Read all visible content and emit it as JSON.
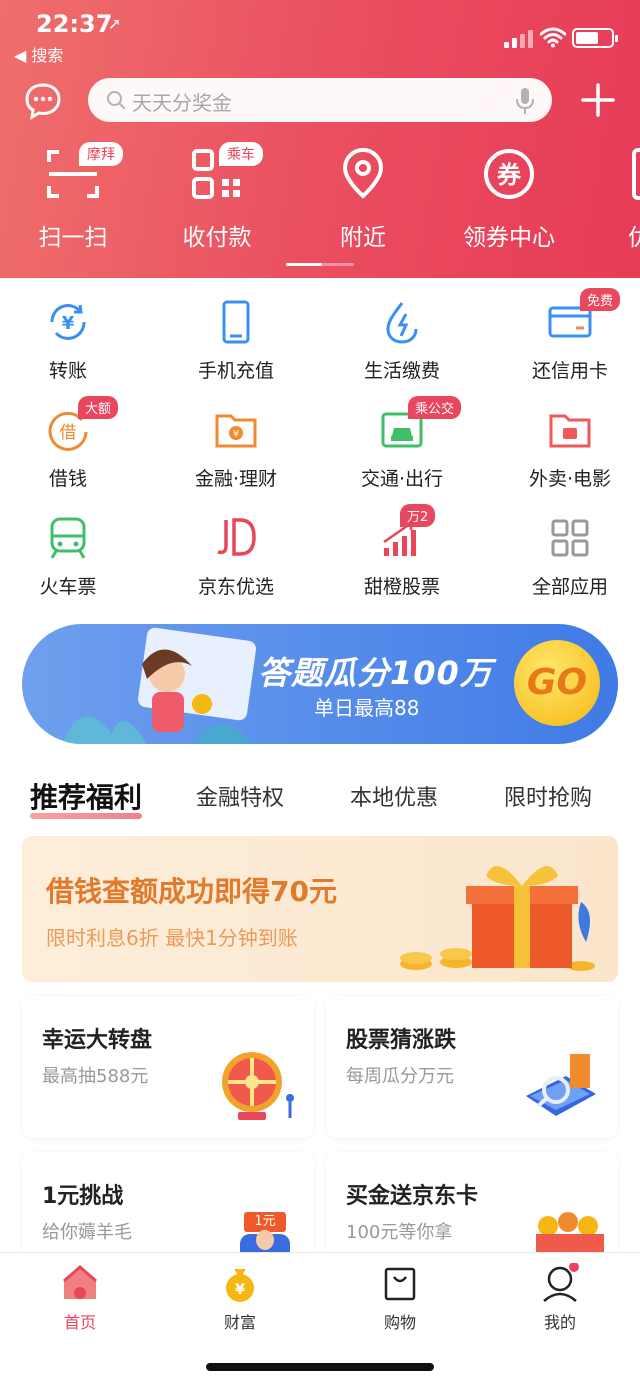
{
  "status": {
    "time": "22:37",
    "back_label": "◀ 搜索"
  },
  "search": {
    "placeholder": "天天分奖金"
  },
  "quick_actions": [
    {
      "label": "扫一扫",
      "badge": "摩拜"
    },
    {
      "label": "收付款",
      "badge": "乘车"
    },
    {
      "label": "附近",
      "badge": ""
    },
    {
      "label": "领券中心",
      "badge": "",
      "glyph": "券"
    },
    {
      "label": "优"
    }
  ],
  "services": [
    {
      "label": "转账",
      "badge": ""
    },
    {
      "label": "手机充值",
      "badge": ""
    },
    {
      "label": "生活缴费",
      "badge": ""
    },
    {
      "label": "还信用卡",
      "badge": "免费"
    },
    {
      "label": "借钱",
      "badge": "大额",
      "glyph": "借"
    },
    {
      "label": "金融·理财",
      "badge": ""
    },
    {
      "label": "交通·出行",
      "badge": "乘公交"
    },
    {
      "label": "外卖·电影",
      "badge": ""
    },
    {
      "label": "火车票",
      "badge": ""
    },
    {
      "label": "京东优选",
      "badge": ""
    },
    {
      "label": "甜橙股票",
      "badge": "万2"
    },
    {
      "label": "全部应用",
      "badge": ""
    }
  ],
  "banner": {
    "title": "答题瓜分100万",
    "subtitle": "单日最高88",
    "cta": "GO"
  },
  "tabs": [
    "推荐福利",
    "金融特权",
    "本地优惠",
    "限时抢购"
  ],
  "promo": {
    "title": "借钱查额成功即得70元",
    "subtitle": "限时利息6折 最快1分钟到账"
  },
  "cards": [
    {
      "title": "幸运大转盘",
      "subtitle": "最高抽588元"
    },
    {
      "title": "股票猜涨跌",
      "subtitle": "每周瓜分万元"
    },
    {
      "title": "1元挑战",
      "subtitle": "给你薅羊毛",
      "tag": "1元"
    },
    {
      "title": "买金送京东卡",
      "subtitle": "100元等你拿"
    }
  ],
  "nav": [
    {
      "label": "首页"
    },
    {
      "label": "财富"
    },
    {
      "label": "购物"
    },
    {
      "label": "我的"
    }
  ],
  "colors": {
    "brand": "#e9455c",
    "banner_blue": "#4a84ea",
    "promo_orange": "#e27a2e"
  }
}
